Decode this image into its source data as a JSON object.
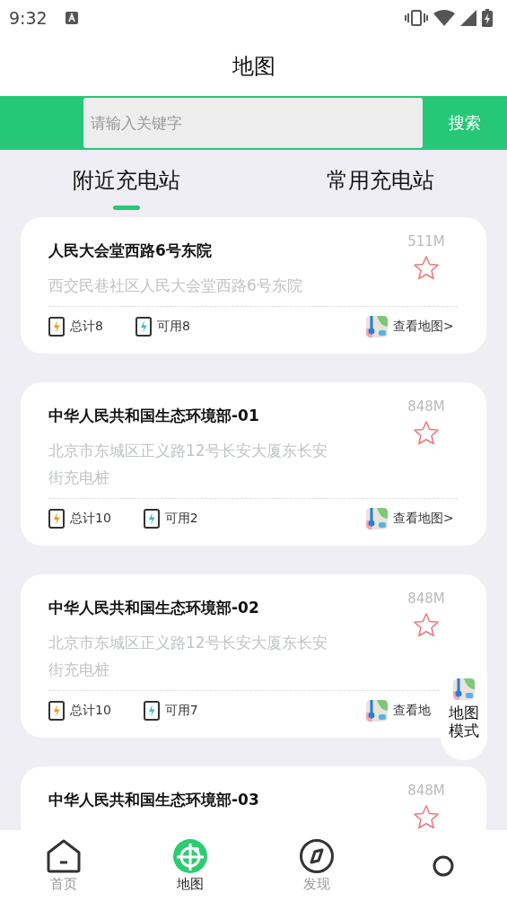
{
  "status_bar": {
    "time": "9:32"
  },
  "header": {
    "title": "地图"
  },
  "search": {
    "placeholder": "请输入关键字",
    "button": "搜索"
  },
  "tabs": [
    {
      "label": "附近充电站",
      "selected": true
    },
    {
      "label": "常用充电站",
      "selected": false
    }
  ],
  "stations": [
    {
      "name": "人民大会堂西路6号东院",
      "address": "西交民巷社区人民大会堂西路6号东院",
      "distance": "511M",
      "favorite": false,
      "total": "总计8",
      "available": "可用8",
      "map_link": "查看地图>"
    },
    {
      "name": "中华人民共和国生态环境部-01",
      "address": "北京市东城区正义路12号长安大厦东长安街充电桩",
      "distance": "848M",
      "favorite": false,
      "total": "总计10",
      "available": "可用2",
      "map_link": "查看地图>"
    },
    {
      "name": "中华人民共和国生态环境部-02",
      "address": "北京市东城区正义路12号长安大厦东长安街充电桩",
      "distance": "848M",
      "favorite": false,
      "total": "总计10",
      "available": "可用7",
      "map_link": "查看地"
    },
    {
      "name": "中华人民共和国生态环境部-03",
      "distance": "848M",
      "favorite": false
    }
  ],
  "map_mode_button": {
    "label": "地图模式"
  },
  "bottom_nav": [
    {
      "label": "首页",
      "kind": "home",
      "selected": false
    },
    {
      "label": "地图",
      "kind": "map",
      "selected": true
    },
    {
      "label": "发现",
      "kind": "compass",
      "selected": false
    },
    {
      "kind": "profile",
      "selected": false
    }
  ]
}
